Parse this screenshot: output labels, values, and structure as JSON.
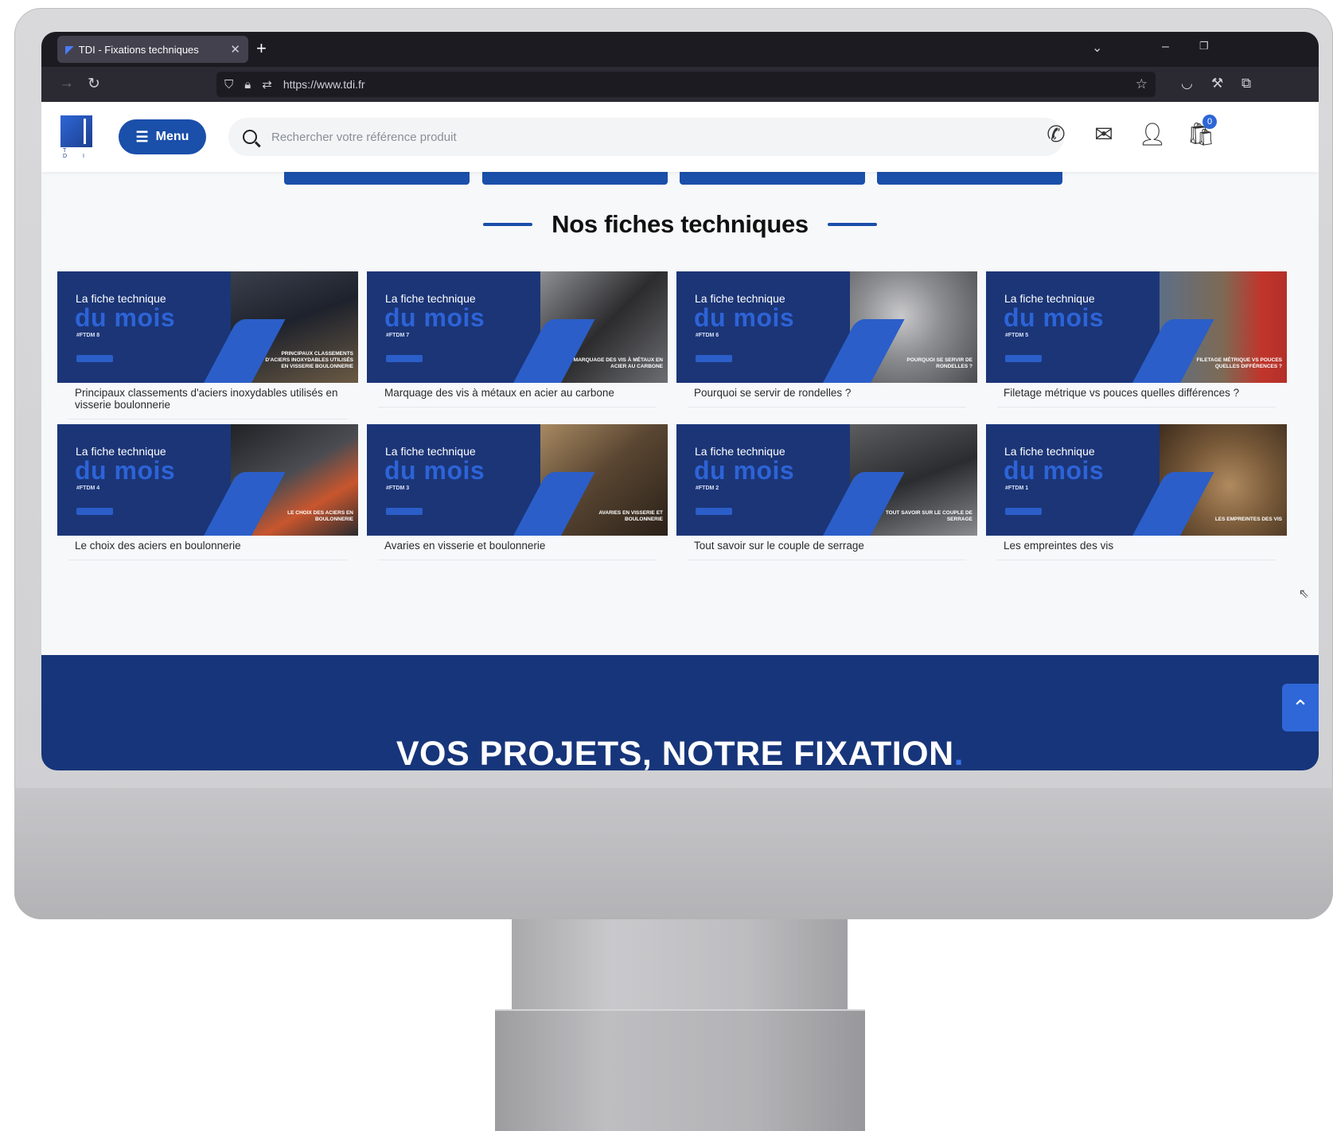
{
  "browser": {
    "tab_title": "TDI - Fixations techniques",
    "tab_close": "✕",
    "new_tab": "+",
    "url": "https://www.tdi.fr",
    "icons": [
      "shield-icon",
      "lock-icon",
      "permissions-icon",
      "star-icon",
      "pocket-icon",
      "wrench-icon",
      "extensions-icon"
    ]
  },
  "header": {
    "logo_letters": "T D I",
    "menu_label": "Menu",
    "search_placeholder": "Rechercher votre référence produit",
    "cart_count": "0",
    "icons": [
      "phone-icon",
      "mail-icon",
      "user-icon",
      "cart-icon"
    ],
    "brand_color": "#1a4faa"
  },
  "section": {
    "title": "Nos fiches techniques"
  },
  "cards": [
    {
      "cap": "La fiche technique",
      "badge": "du mois",
      "ftdm": "#FTDM 8",
      "photo_caption": "Principaux classements d'aciers inoxydables utilisés en visserie boulonnerie",
      "text": "Principaux classements d'aciers inoxydables utilisés en visserie boulonnerie"
    },
    {
      "cap": "La fiche technique",
      "badge": "du mois",
      "ftdm": "#FTDM 7",
      "photo_caption": "Marquage des vis à métaux en acier au carbone",
      "text": "Marquage des vis à métaux en acier au carbone"
    },
    {
      "cap": "La fiche technique",
      "badge": "du mois",
      "ftdm": "#FTDM 6",
      "photo_caption": "Pourquoi se servir de rondelles ?",
      "text": "Pourquoi se servir de rondelles ?"
    },
    {
      "cap": "La fiche technique",
      "badge": "du mois",
      "ftdm": "#FTDM 5",
      "photo_caption": "Filetage métrique vs pouces quelles différences ?",
      "text": "Filetage métrique vs pouces quelles différences ?"
    },
    {
      "cap": "La fiche technique",
      "badge": "du mois",
      "ftdm": "#FTDM 4",
      "photo_caption": "Le choix des aciers en boulonnerie",
      "text": "Le choix des aciers en boulonnerie"
    },
    {
      "cap": "La fiche technique",
      "badge": "du mois",
      "ftdm": "#FTDM 3",
      "photo_caption": "Avaries en visserie et boulonnerie",
      "text": "Avaries en visserie et boulonnerie"
    },
    {
      "cap": "La fiche technique",
      "badge": "du mois",
      "ftdm": "#FTDM 2",
      "photo_caption": "Tout savoir sur le couple de serrage",
      "text": "Tout savoir sur le couple de serrage"
    },
    {
      "cap": "La fiche technique",
      "badge": "du mois",
      "ftdm": "#FTDM 1",
      "photo_caption": "Les empreintes des vis",
      "text": "Les empreintes des vis"
    }
  ],
  "footer": {
    "title": "VOS PROJETS, NOTRE FIXATION",
    "title_dot": "."
  }
}
